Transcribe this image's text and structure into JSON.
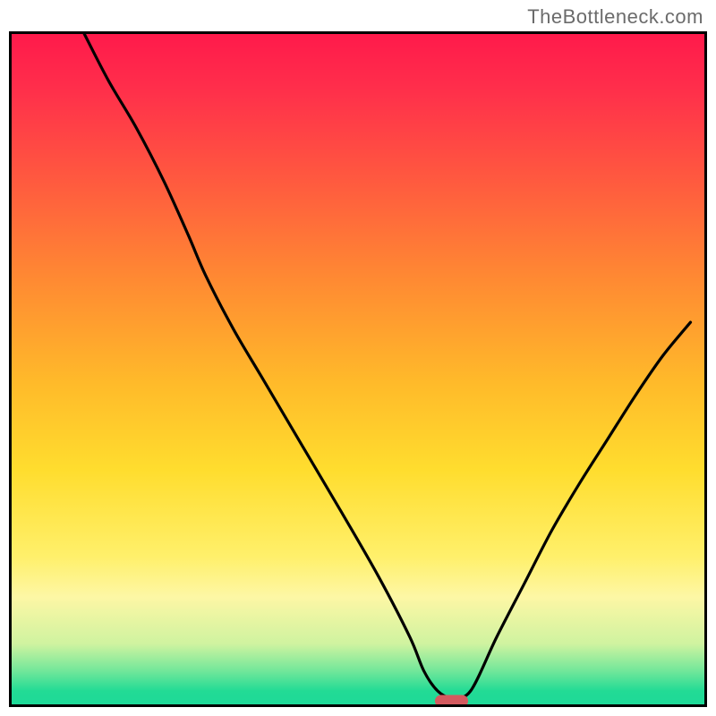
{
  "attribution": "TheBottleneck.com",
  "chart_data": {
    "type": "line",
    "title": "",
    "xlabel": "",
    "ylabel": "",
    "xlim_pct": [
      0,
      100
    ],
    "ylim_pct": [
      0,
      100
    ],
    "series": [
      {
        "name": "bottleneck-curve",
        "x_pct": [
          10.5,
          14,
          18,
          22,
          25.5,
          28,
          32,
          36,
          40,
          44,
          48,
          53,
          57.5,
          59.5,
          61.5,
          63.5,
          66.25,
          70,
          74,
          78,
          82,
          86,
          90,
          94,
          98
        ],
        "y_pct": [
          100,
          93,
          86,
          78,
          70,
          64,
          56,
          49,
          42,
          35,
          28,
          19,
          10,
          5,
          2,
          1,
          2,
          10,
          18,
          26,
          33,
          39.5,
          46,
          52,
          57
        ]
      }
    ],
    "marker": {
      "x_pct": 63.5,
      "y_pct": 0.5,
      "width_pct": 4.8,
      "height_pct": 1.8,
      "rx_pct": 0.9,
      "color": "#d35a5f"
    },
    "colors": {
      "curve": "#000000",
      "frame": "#000000",
      "gradient_stops": [
        "#ff1a4b",
        "#ff5a3f",
        "#ff8b32",
        "#ffba2a",
        "#ffdd2e",
        "#fff06b",
        "#fdf7a5",
        "#72e79a",
        "#1ed998"
      ]
    }
  }
}
